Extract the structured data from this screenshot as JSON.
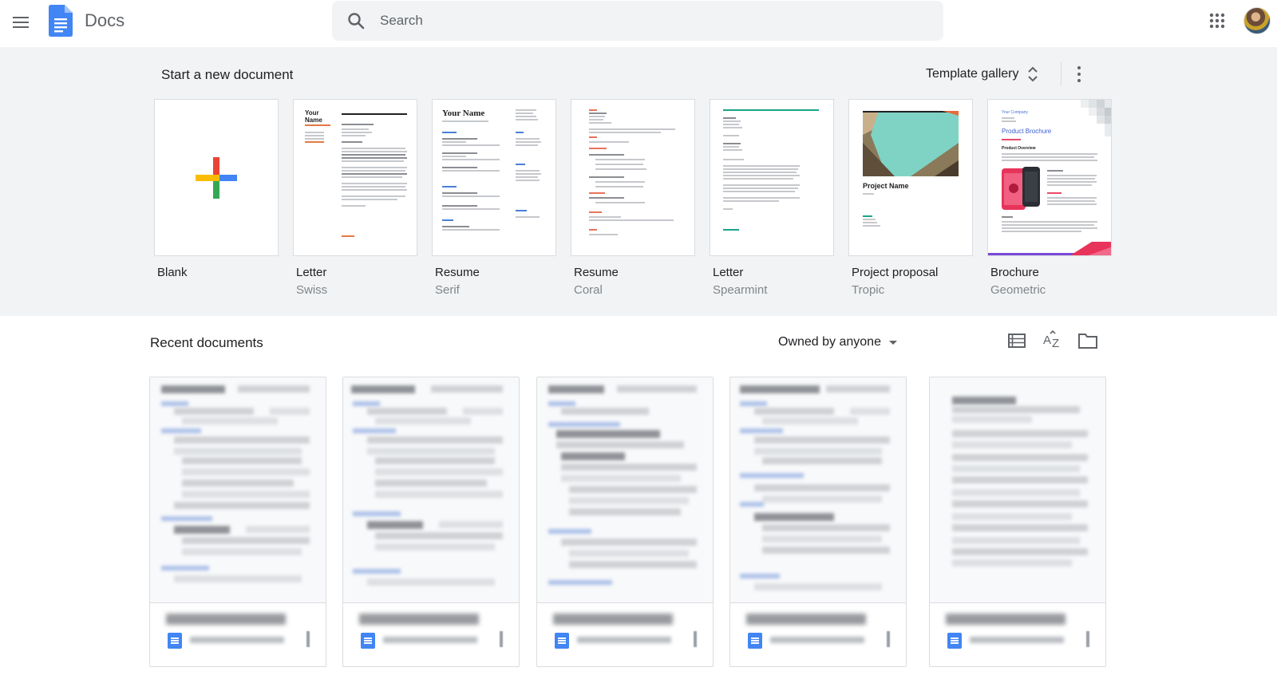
{
  "header": {
    "app_name": "Docs",
    "search_placeholder": "Search",
    "brand_color": "#4285f4"
  },
  "templates": {
    "heading": "Start a new document",
    "gallery_label": "Template gallery",
    "items": [
      {
        "name": "Blank",
        "subtitle": ""
      },
      {
        "name": "Letter",
        "subtitle": "Swiss"
      },
      {
        "name": "Resume",
        "subtitle": "Serif"
      },
      {
        "name": "Resume",
        "subtitle": "Coral"
      },
      {
        "name": "Letter",
        "subtitle": "Spearmint"
      },
      {
        "name": "Project proposal",
        "subtitle": "Tropic"
      },
      {
        "name": "Brochure",
        "subtitle": "Geometric"
      }
    ],
    "thumb_text": {
      "swiss_name": "Your Name",
      "serif_name": "Your Name",
      "tropic_title": "Project Name",
      "geo_company": "Your Company",
      "geo_title": "Product Brochure",
      "geo_section": "Product Overview"
    }
  },
  "recent": {
    "heading": "Recent documents",
    "owner_filter": "Owned by anyone",
    "documents_count_visible": 5
  },
  "icons": {
    "menu": "menu-icon",
    "search": "search-icon",
    "apps": "apps-grid-icon",
    "gallery_toggle": "unfold-icon",
    "more": "more-vert-icon",
    "list_view": "list-view-icon",
    "sort": "sort-az-icon",
    "folder": "folder-icon"
  }
}
